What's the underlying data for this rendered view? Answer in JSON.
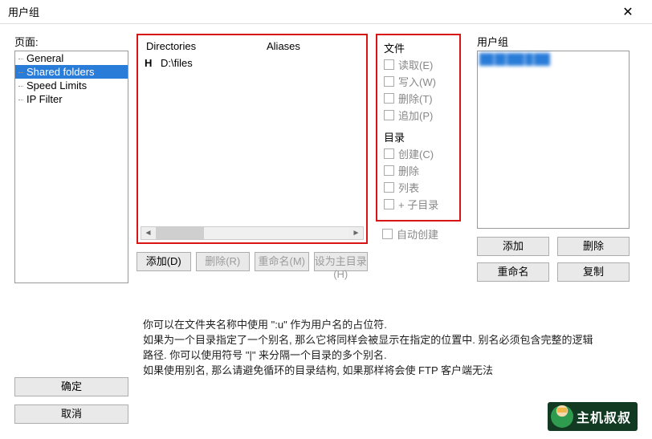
{
  "window": {
    "title": "用户组"
  },
  "left": {
    "label": "页面:",
    "items": [
      "General",
      "Shared folders",
      "Speed Limits",
      "IP Filter"
    ],
    "selected_index": 1
  },
  "center": {
    "columns": {
      "directories": "Directories",
      "aliases": "Aliases"
    },
    "rows": [
      {
        "home": "H",
        "path": "D:\\files",
        "alias": ""
      }
    ],
    "buttons": {
      "add": "添加(D)",
      "remove": "删除(R)",
      "rename": "重命名(M)",
      "set_home": "设为主目录(H)"
    }
  },
  "perm": {
    "file_label": "文件",
    "file": {
      "read": "读取(E)",
      "write": "写入(W)",
      "delete": "删除(T)",
      "append": "追加(P)"
    },
    "dir_label": "目录",
    "dir": {
      "create": "创建(C)",
      "delete": "删除",
      "list": "列表",
      "subdirs": "+ 子目录"
    },
    "auto_create": "自动创建"
  },
  "right": {
    "label": "用户组",
    "buttons": {
      "add": "添加",
      "remove": "删除",
      "rename": "重命名",
      "copy": "复制"
    }
  },
  "info": {
    "line1": "你可以在文件夹名称中使用 \":u\" 作为用户名的占位符.",
    "line2": "如果为一个目录指定了一个别名, 那么它将同样会被显示在指定的位置中. 别名必须包含完整的逻辑路径. 你可以使用符号 \"|\" 来分隔一个目录的多个别名.",
    "line3": "如果使用别名, 那么请避免循环的目录结构, 如果那样将会使 FTP 客户端无法"
  },
  "bottom": {
    "ok": "确定",
    "cancel": "取消"
  },
  "badge": {
    "text": "主机叔叔"
  }
}
